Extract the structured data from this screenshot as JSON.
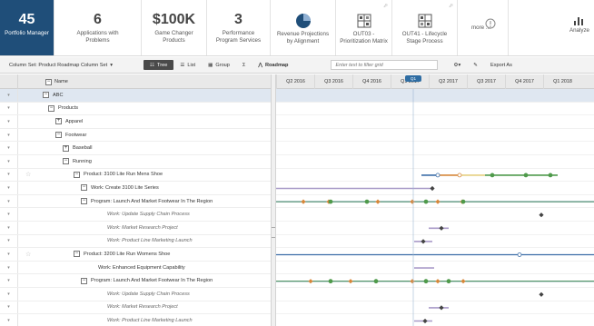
{
  "tiles": [
    {
      "value": "45",
      "label": "Portfolio Manager",
      "active": true
    },
    {
      "value": "6",
      "label": "Applications with Problems"
    },
    {
      "value": "$100K",
      "label": "Game Changer Products"
    },
    {
      "value": "3",
      "label": "Performance Program Services"
    },
    {
      "icon": "pie-chart-icon",
      "label": "Revenue Projections by Alignment"
    },
    {
      "icon": "matrix-icon",
      "label": "OUT03 - Prioritization Matrix"
    },
    {
      "icon": "matrix-icon",
      "label": "OUT41 - Lifecycle Stage Process"
    },
    {
      "icon": "info-icon",
      "label": "more ..."
    },
    {
      "icon": "bar-chart-icon",
      "label": "Analyze"
    }
  ],
  "toolbar": {
    "column_set": "Column Set: Product Roadmap Column Set",
    "tree_label": "Tree",
    "list_label": "List",
    "group_label": "Group",
    "sigma": "Σ",
    "roadmap_label": "Roadmap",
    "filter_placeholder": "Enter text to filter grid",
    "export_label": "Export As"
  },
  "grid": {
    "name_header": "Name",
    "quarters": [
      "Q2 2016",
      "Q3 2016",
      "Q4 2016",
      "Q1 2017",
      "Q2 2017",
      "Q3 2017",
      "Q4 2017",
      "Q1 2018"
    ],
    "today_label": "Q1"
  },
  "rows": [
    {
      "label": "ABC",
      "box": "−",
      "hl": true
    },
    {
      "label": "Products",
      "box": "−"
    },
    {
      "label": "Apparel",
      "box": "+"
    },
    {
      "label": "Footwear",
      "box": "−"
    },
    {
      "label": "Baseball",
      "box": "+"
    },
    {
      "label": "Running",
      "box": "−"
    },
    {
      "label": "Product: 3100 Lite Run Mens Shoe",
      "box": "−",
      "star": true
    },
    {
      "label": "Work: Create 3100 Lite Series",
      "box": "−"
    },
    {
      "label": "Program: Launch And Market Footwear In The Region",
      "box": "−"
    },
    {
      "label": "Work: Update Supply Chain Process",
      "italic": true
    },
    {
      "label": "Work: Market Research Project",
      "italic": true
    },
    {
      "label": "Work: Product Line Marketing Launch",
      "italic": true
    },
    {
      "label": "Product: 3200 Lite Run Womens Shoe",
      "box": "−",
      "star": true
    },
    {
      "label": "Work: Enhanced Equipment Capability"
    },
    {
      "label": "Program: Launch And Market Footwear In The Region",
      "box": "−"
    },
    {
      "label": "Work: Update Supply Chain Process",
      "italic": true
    },
    {
      "label": "Work: Market Research Project",
      "italic": true
    },
    {
      "label": "Work: Product Line Marketing Launch",
      "italic": true
    }
  ],
  "colors": {
    "header_active": "#1f4e79",
    "bar_blue": "#3d6ea8",
    "bar_green": "#4f9a4b",
    "bar_orange": "#d6873a",
    "bar_purple": "#a89ac8",
    "milestone": "#444444"
  }
}
